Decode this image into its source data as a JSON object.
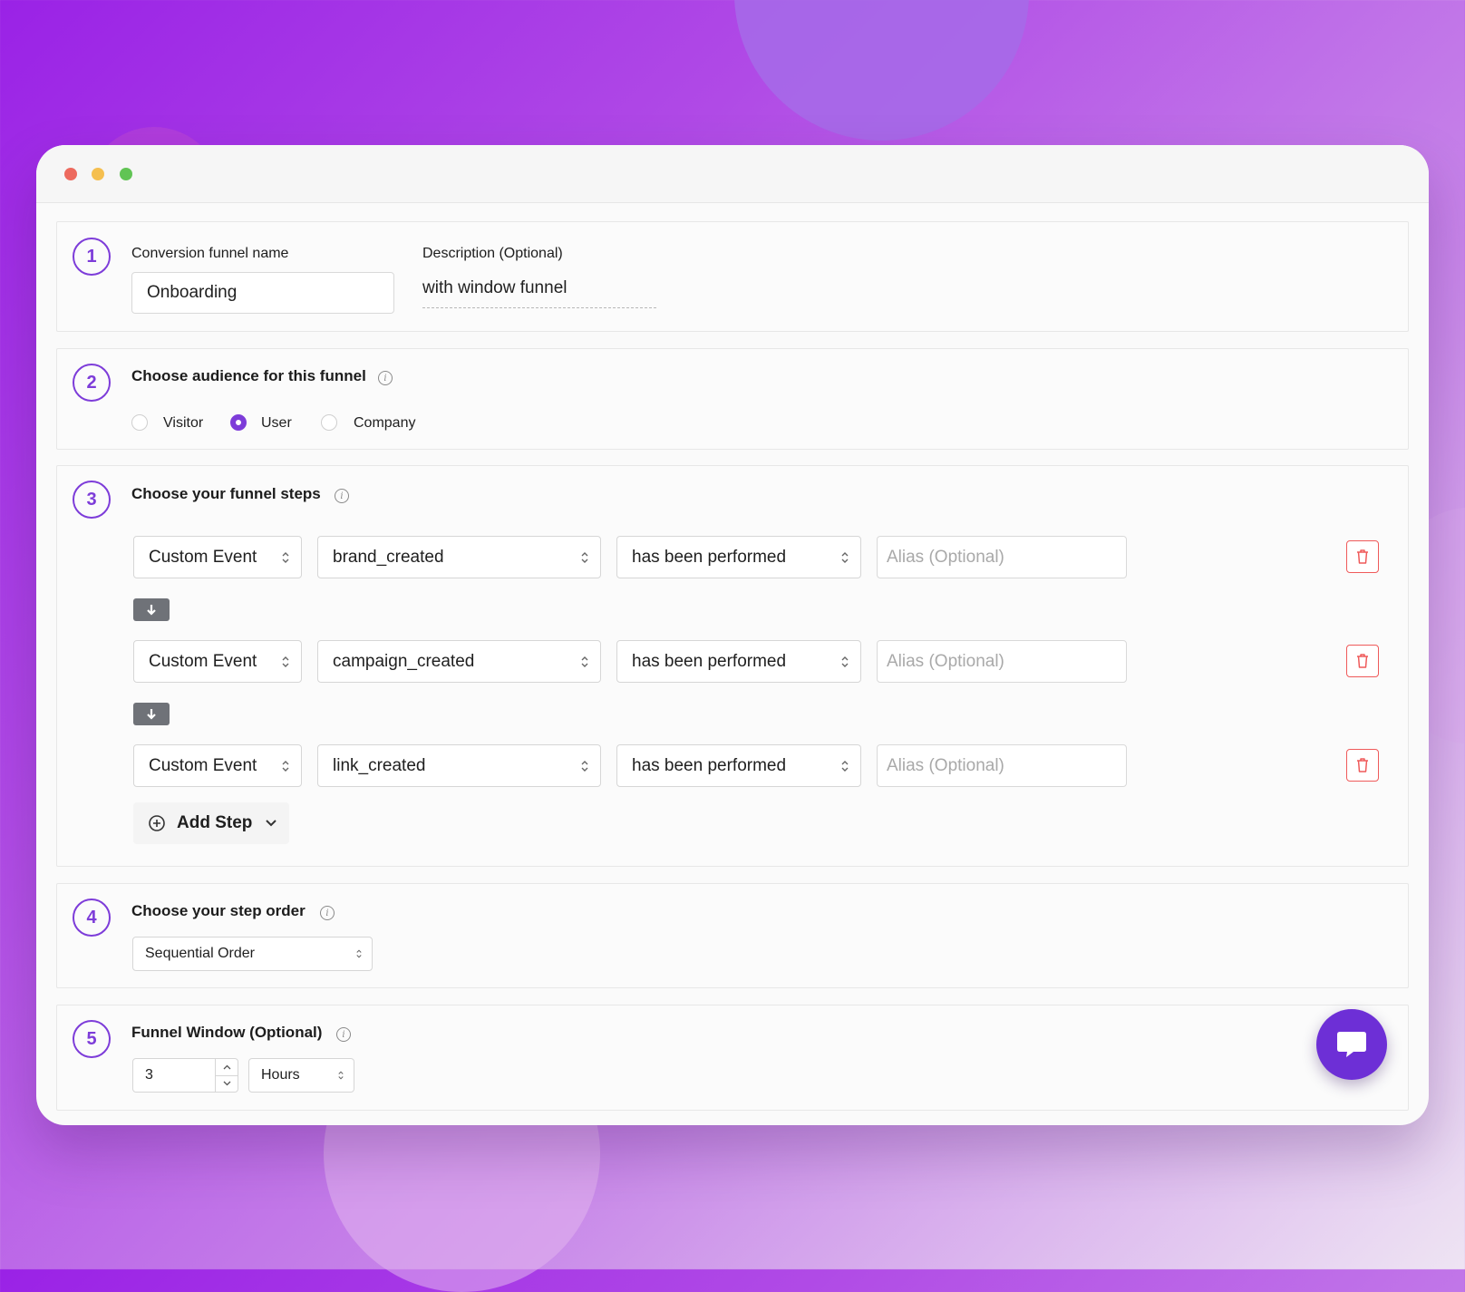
{
  "section1": {
    "number": "1",
    "name_label": "Conversion funnel name",
    "name_value": "Onboarding",
    "description_label": "Description (Optional)",
    "description_value": "with window funnel"
  },
  "section2": {
    "number": "2",
    "title": "Choose audience for this funnel",
    "options": [
      {
        "label": "Visitor",
        "checked": false
      },
      {
        "label": "User",
        "checked": true
      },
      {
        "label": "Company",
        "checked": false
      }
    ]
  },
  "section3": {
    "number": "3",
    "title": "Choose your funnel steps",
    "steps": [
      {
        "type": "Custom Event",
        "event": "brand_created",
        "condition": "has been performed",
        "alias_placeholder": "Alias (Optional)"
      },
      {
        "type": "Custom Event",
        "event": "campaign_created",
        "condition": "has been performed",
        "alias_placeholder": "Alias (Optional)"
      },
      {
        "type": "Custom Event",
        "event": "link_created",
        "condition": "has been performed",
        "alias_placeholder": "Alias (Optional)"
      }
    ],
    "add_step_label": "Add Step"
  },
  "section4": {
    "number": "4",
    "title": "Choose your step order",
    "order_value": "Sequential Order"
  },
  "section5": {
    "number": "5",
    "title": "Funnel Window (Optional)",
    "window_value": "3",
    "unit_value": "Hours"
  },
  "colors": {
    "accent": "#7d3cd9",
    "danger": "#ef5a5a",
    "chat": "#6d2fd6"
  },
  "icons": [
    "info-icon",
    "chevron-updown-icon",
    "trash-icon",
    "arrow-down-icon",
    "plus-circle-icon",
    "chevron-down-icon",
    "chat-icon"
  ]
}
